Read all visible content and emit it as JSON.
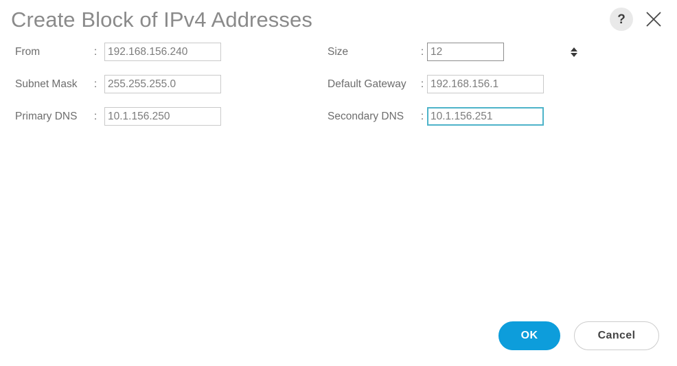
{
  "dialog": {
    "title": "Create Block of IPv4 Addresses",
    "help_icon": "question-mark-icon",
    "close_icon": "close-icon",
    "colon": ":"
  },
  "form": {
    "left_column": [
      {
        "label": "From",
        "value": "192.168.156.240",
        "placeholder": "",
        "type": "text",
        "focused": false
      },
      {
        "label": "Subnet Mask",
        "value": "255.255.255.0",
        "placeholder": "",
        "type": "text",
        "focused": false
      },
      {
        "label": "Primary DNS",
        "value": "10.1.156.250",
        "placeholder": "",
        "type": "text",
        "focused": false
      }
    ],
    "right_column": [
      {
        "label": "Size",
        "value": "12",
        "placeholder": "",
        "type": "number-spinner",
        "focused": false
      },
      {
        "label": "Default Gateway",
        "value": "192.168.156.1",
        "placeholder": "",
        "type": "text",
        "focused": false
      },
      {
        "label": "Secondary DNS",
        "value": "10.1.156.251",
        "placeholder": "",
        "type": "text",
        "focused": true
      }
    ]
  },
  "footer": {
    "ok_label": "OK",
    "cancel_label": "Cancel"
  },
  "colors": {
    "accent_blue": "#0d9ddb",
    "focus_border": "#4db3c9",
    "title_gray": "#8a8a8a",
    "label_gray": "#6d6d6d",
    "input_border": "#c9c9c9",
    "input_text": "#7c7c7c",
    "spinner_border": "#8d8d8d",
    "cancel_border": "#cccccc",
    "help_bg": "#e9e9e9"
  }
}
